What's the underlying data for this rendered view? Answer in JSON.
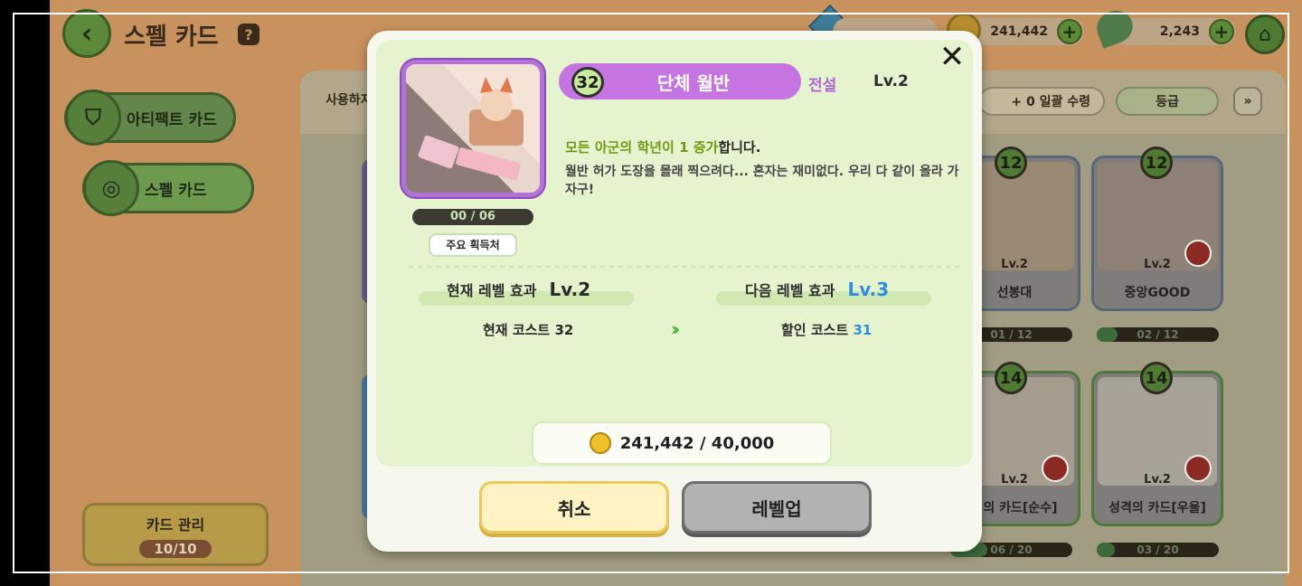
{
  "header": {
    "back_icon": "‹",
    "title": "스펠 카드",
    "help_icon": "?",
    "gem_amount": "",
    "gold_amount": "241,442",
    "leaf_amount": "2,243",
    "plus": "+",
    "home_icon": "⌂"
  },
  "sidebar": {
    "items": [
      {
        "label": "아티팩트 카드",
        "icon": "shield-icon"
      },
      {
        "label": "스펠 카드",
        "icon": "spell-swirl-icon"
      }
    ],
    "card_mgmt_label": "카드 관리",
    "card_mgmt_count": "10/10"
  },
  "panel": {
    "use_label": "사용하지",
    "bulk_receive": "+ 0   일괄 수령",
    "grade_sort": "등급",
    "expand": "»"
  },
  "background_cards": [
    {
      "level": "12",
      "card_level": "Lv.2",
      "name": "선봉대",
      "progress": "01 / 12",
      "fill": 0.08
    },
    {
      "level": "12",
      "card_level": "Lv.2",
      "name": "중앙GOOD",
      "progress": "02 / 12",
      "fill": 0.17
    },
    {
      "level": "14",
      "card_level": "Lv.2",
      "name": "격의 카드[순수]",
      "progress": "06 / 20",
      "fill": 0.3
    },
    {
      "level": "14",
      "card_level": "Lv.2",
      "name": "성격의 카드[우울]",
      "progress": "03 / 20",
      "fill": 0.15
    }
  ],
  "modal": {
    "close_icon": "✕",
    "cost": "32",
    "card_name": "단체 월반",
    "grade": "전설",
    "level": "Lv.2",
    "owned_count": "00 / 06",
    "source_button": "주요 획득처",
    "effect_highlight": "모든 아군의 학년이 1 증가",
    "effect_suffix": "합니다.",
    "description": "월반 허가 도장을 몰래 찍으려다... 혼자는 재미없다. 우리 다 같이 올라 가자구!",
    "current_level_label": "현재 레벨 효과",
    "current_level_value": "Lv.2",
    "next_level_label": "다음 레벨 효과",
    "next_level_value": "Lv.3",
    "current_cost_label": "현재 코스트 32",
    "next_cost_label": "할인 코스트",
    "next_cost_value": "31",
    "arrows": "»",
    "gold_text": "241,442 / 40,000",
    "cancel_button": "취소",
    "levelup_button": "레벨업"
  }
}
